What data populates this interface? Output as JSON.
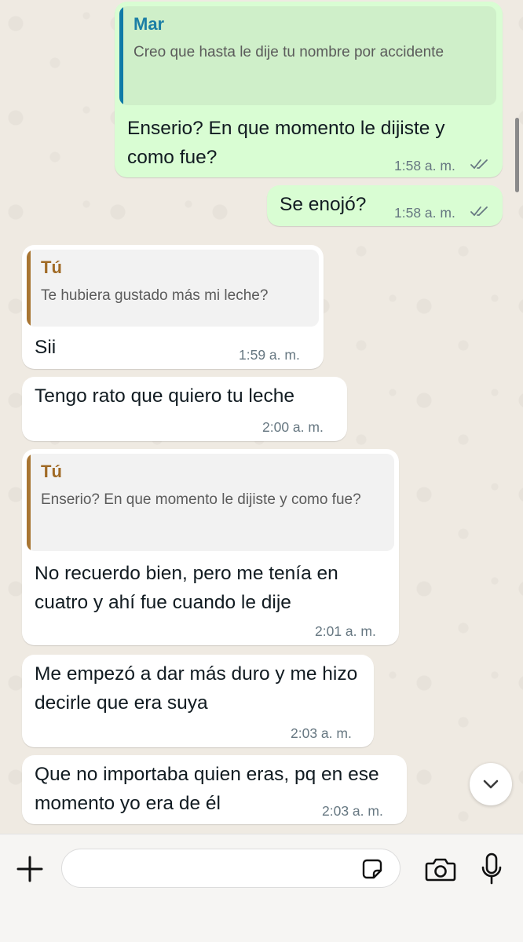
{
  "messages": [
    {
      "direction": "outgoing",
      "quote": {
        "author": "Mar",
        "text": "Creo que hasta le dije tu nombre por accidente"
      },
      "text": "Enserio? En que momento le dijiste y como fue?",
      "time": "1:58 a. m.",
      "status": "read"
    },
    {
      "direction": "outgoing",
      "text": "Se enojó?",
      "time": "1:58 a. m.",
      "status": "read"
    },
    {
      "direction": "incoming",
      "quote": {
        "author": "Tú",
        "text": "Te hubiera gustado más mi leche?"
      },
      "text": "Sii",
      "time": "1:59 a. m."
    },
    {
      "direction": "incoming",
      "text": "Tengo rato que quiero tu leche",
      "time": "2:00 a. m."
    },
    {
      "direction": "incoming",
      "quote": {
        "author": "Tú",
        "text": "Enserio? En que momento le dijiste y como fue?"
      },
      "text": "No recuerdo bien, pero me tenía en cuatro y ahí fue cuando le dije",
      "time": "2:01 a. m."
    },
    {
      "direction": "incoming",
      "text": "Me empezó a dar más duro y me hizo decirle que era suya",
      "time": "2:03 a. m."
    },
    {
      "direction": "incoming",
      "text": "Que no importaba quien eras, pq en ese momento yo era de él",
      "time": "2:03 a. m."
    }
  ],
  "composer": {
    "placeholder": "",
    "value": ""
  },
  "icons": {
    "add": "plus-icon",
    "sticker": "sticker-icon",
    "camera": "camera-icon",
    "microphone": "microphone-icon",
    "scroll_down": "chevron-down-icon",
    "read_status": "double-check-icon"
  },
  "colors": {
    "outgoing_bubble": "#d9fdd3",
    "incoming_bubble": "#ffffff",
    "chat_background": "#efeae2",
    "quote_bar_mar": "#0f7aa7",
    "quote_bar_tu": "#a87532",
    "ticks": "#667781"
  }
}
